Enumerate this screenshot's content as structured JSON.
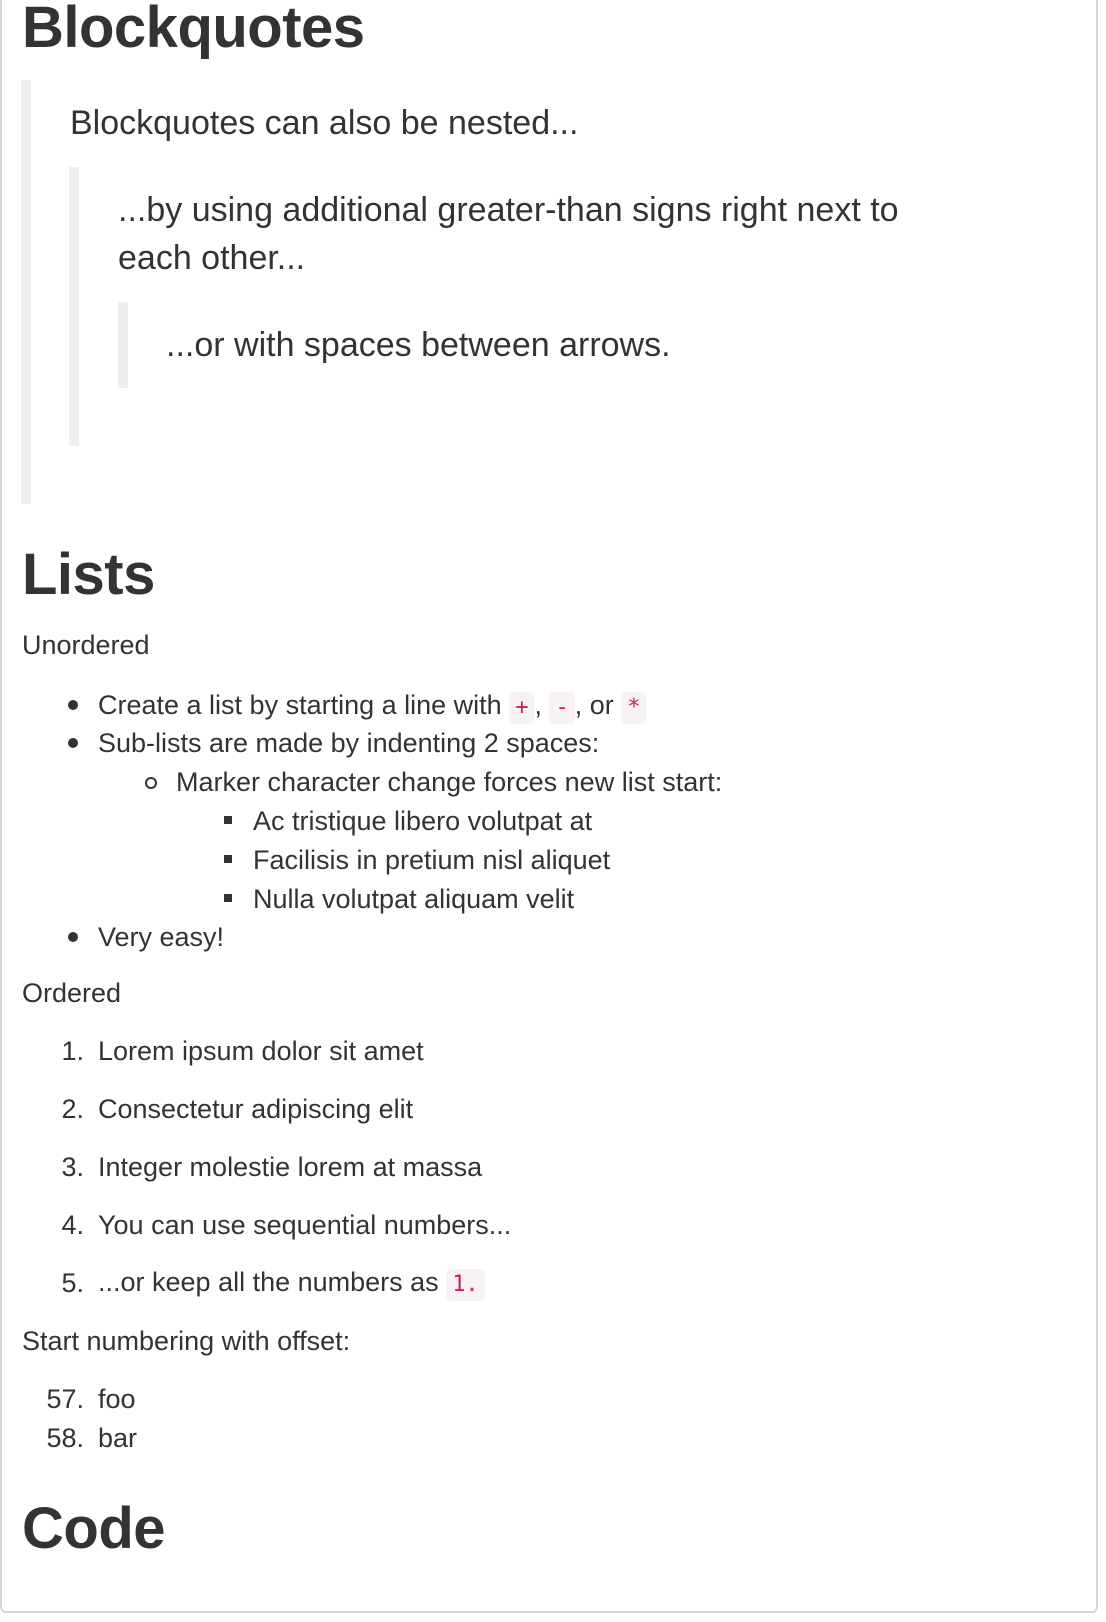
{
  "headings": {
    "blockquotes": "Blockquotes",
    "lists": "Lists",
    "code": "Code"
  },
  "blockquotes": {
    "level1": "Blockquotes can also be nested...",
    "level2_line1": "...by using additional greater-than signs right next to",
    "level2_line2": "each other...",
    "level3": "...or with spaces between arrows."
  },
  "lists": {
    "unordered_label": "Unordered",
    "unordered": {
      "item1_prefix": "Create a list by starting a line with ",
      "item1_code1": "+",
      "item1_sep1": ", ",
      "item1_code2": "-",
      "item1_sep2": ", or ",
      "item1_code3": "*",
      "item2": "Sub-lists are made by indenting 2 spaces:",
      "item2_sub": "Marker character change forces new list start:",
      "item2_subsub": [
        "Ac tristique libero volutpat at",
        "Facilisis in pretium nisl aliquet",
        "Nulla volutpat aliquam velit"
      ],
      "item3": "Very easy!"
    },
    "ordered_label": "Ordered",
    "ordered": [
      {
        "num": "1.",
        "text": "Lorem ipsum dolor sit amet"
      },
      {
        "num": "2.",
        "text": "Consectetur adipiscing elit"
      },
      {
        "num": "3.",
        "text": "Integer molestie lorem at massa"
      },
      {
        "num": "4.",
        "text": "You can use sequential numbers..."
      },
      {
        "num": "5.",
        "text": "...or keep all the numbers as "
      }
    ],
    "ordered_item5_code": "1.",
    "offset_label": "Start numbering with offset:",
    "offset": [
      {
        "num": "57.",
        "text": "foo"
      },
      {
        "num": "58.",
        "text": "bar"
      }
    ]
  }
}
